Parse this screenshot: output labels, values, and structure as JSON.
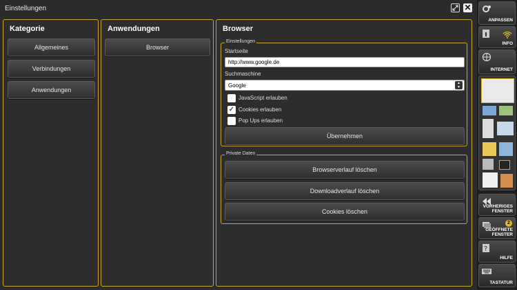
{
  "window": {
    "title": "Einstellungen"
  },
  "kategorie": {
    "title": "Kategorie",
    "items": [
      "Allgemeines",
      "Verbindungen",
      "Anwendungen"
    ]
  },
  "anwendungen": {
    "title": "Anwendungen",
    "items": [
      "Browser"
    ]
  },
  "browser": {
    "title": "Browser",
    "settings": {
      "group_label": "Einstellungen",
      "startseite_label": "Startseite",
      "startseite_value": "http://www.google.de",
      "suchmaschine_label": "Suchmaschine",
      "suchmaschine_value": "Google",
      "checkboxes": [
        {
          "label": "JavaScript erlauben",
          "checked": false
        },
        {
          "label": "Cookies erlauben",
          "checked": true
        },
        {
          "label": "Pop Ups erlauben",
          "checked": false
        }
      ],
      "apply_label": "Übernehmen"
    },
    "private": {
      "group_label": "Private Daten",
      "buttons": [
        "Browserverlauf löschen",
        "Downloadverlauf löschen",
        "Cookies löschen"
      ]
    }
  },
  "sidebar": {
    "anpassen": "ANPASSEN",
    "info": "INFO",
    "internet": "INTERNET",
    "vorheriges_line1": "VORHERIGES",
    "vorheriges_line2": "FENSTER",
    "geoeffnete_line1": "GEÖFFNETE",
    "geoeffnete_line2": "FENSTER",
    "geoeffnete_count": "2",
    "hilfe": "HILFE",
    "tastatur": "TASTATUR"
  },
  "colors": {
    "accent": "#c9a733",
    "background": "#2b2b2b"
  }
}
